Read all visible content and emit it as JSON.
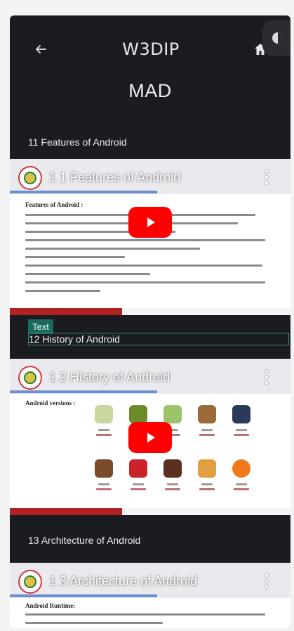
{
  "header": {
    "brand": "W3DIP",
    "back_icon": "arrow-left-icon",
    "home_icon": "home-icon",
    "theme_icon": "theme-toggle-icon"
  },
  "subject": {
    "title": "MAD"
  },
  "topics": [
    {
      "label": "11 Features of Android",
      "video_title": "1 1 Features of Android",
      "slide_heading": "Features of Android :"
    },
    {
      "label": "12 History of Android",
      "video_title": "1 2 History of Android",
      "slide_heading": "Android versions :"
    },
    {
      "label": "13 Architecture of Android",
      "video_title": "1 3 Architecture of Android",
      "slide_heading": "Android Runtime:"
    }
  ],
  "inspector": {
    "tag_label": "Text"
  },
  "colors": {
    "background": "#1b1b22",
    "accent_play": "#ff0000",
    "selection": "#2f8a78"
  }
}
